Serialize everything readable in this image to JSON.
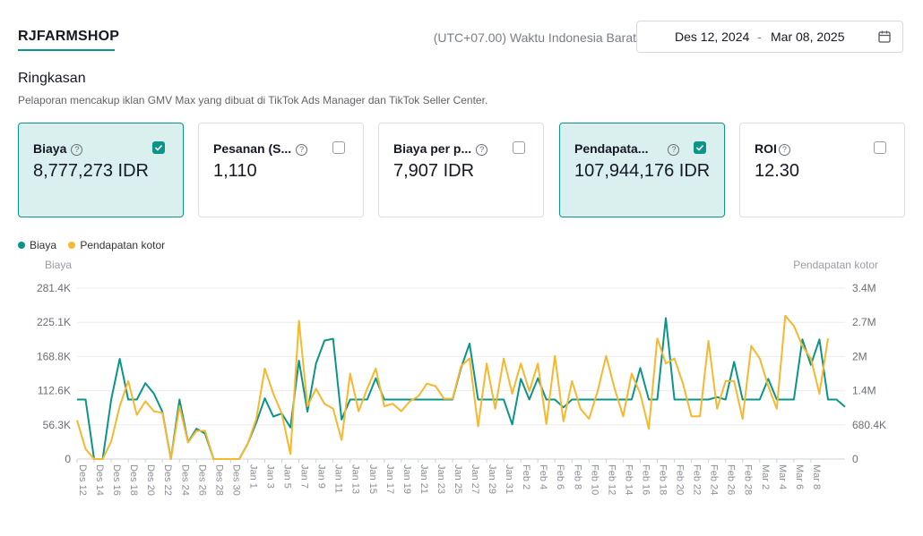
{
  "shop": {
    "name": "RJFARMSHOP"
  },
  "header": {
    "timezone": "(UTC+07.00) Waktu Indonesia Barat",
    "date_start": "Des 12, 2024",
    "date_sep": "-",
    "date_end": "Mar 08, 2025",
    "calendar_icon": "calendar-icon"
  },
  "summary": {
    "title": "Ringkasan",
    "description": "Pelaporan mencakup iklan GMV Max yang dibuat di TikTok Ads Manager dan TikTok Seller Center."
  },
  "cards": [
    {
      "label": "Biaya",
      "value": "8,777,273 IDR",
      "checked": true
    },
    {
      "label": "Pesanan (S...",
      "value": "1,110",
      "checked": false
    },
    {
      "label": "Biaya per p...",
      "value": "7,907 IDR",
      "checked": false
    },
    {
      "label": "Pendapata...",
      "value": "107,944,176 IDR",
      "checked": true
    },
    {
      "label": "ROI",
      "value": "12.30",
      "checked": false
    }
  ],
  "legend": {
    "series1": "Biaya",
    "series2": "Pendapatan kotor"
  },
  "colors": {
    "biaya": "#0d9488",
    "pendapatan": "#f5b82e",
    "accent": "#0d9488"
  },
  "chart_data": {
    "type": "line",
    "left_axis_title": "Biaya",
    "right_axis_title": "Pendapatan kotor",
    "left_ticks": [
      "0",
      "56.3K",
      "112.6K",
      "168.8K",
      "225.1K",
      "281.4K"
    ],
    "right_ticks": [
      "0",
      "680.4K",
      "1.4M",
      "2M",
      "2.7M",
      "3.4M"
    ],
    "left_ylim": [
      0,
      281400
    ],
    "right_ylim": [
      0,
      3400000
    ],
    "x_labels": [
      "Des 12",
      "Des 14",
      "Des 16",
      "Des 18",
      "Des 20",
      "Des 22",
      "Des 24",
      "Des 26",
      "Des 28",
      "Des 30",
      "Jan 1",
      "Jan 3",
      "Jan 5",
      "Jan 7",
      "Jan 9",
      "Jan 11",
      "Jan 13",
      "Jan 15",
      "Jan 17",
      "Jan 19",
      "Jan 21",
      "Jan 23",
      "Jan 25",
      "Jan 27",
      "Jan 29",
      "Jan 31",
      "Feb 2",
      "Feb 4",
      "Feb 6",
      "Feb 8",
      "Feb 10",
      "Feb 12",
      "Feb 14",
      "Feb 16",
      "Feb 18",
      "Feb 20",
      "Feb 22",
      "Feb 24",
      "Feb 26",
      "Feb 28",
      "Mar 2",
      "Mar 4",
      "Mar 6",
      "Mar 8"
    ],
    "grid": true,
    "series": [
      {
        "name": "Biaya",
        "axis": "left",
        "values": [
          98000,
          98000,
          0,
          0,
          98000,
          165000,
          98000,
          98000,
          125000,
          108000,
          78000,
          0,
          98000,
          28000,
          50000,
          42000,
          0,
          0,
          0,
          0,
          25000,
          60000,
          100000,
          70000,
          75000,
          52000,
          162000,
          78000,
          157000,
          195000,
          198000,
          65000,
          98000,
          98000,
          98000,
          133000,
          98000,
          98000,
          98000,
          98000,
          98000,
          98000,
          98000,
          98000,
          98000,
          150000,
          190000,
          98000,
          98000,
          98000,
          98000,
          57000,
          132000,
          98000,
          133000,
          98000,
          98000,
          85000,
          98000,
          98000,
          98000,
          98000,
          98000,
          98000,
          98000,
          98000,
          150000,
          98000,
          98000,
          232000,
          98000,
          98000,
          98000,
          98000,
          98000,
          102000,
          98000,
          160000,
          98000,
          98000,
          98000,
          132000,
          98000,
          98000,
          98000,
          197000,
          155000,
          197000,
          98000,
          98000,
          86000
        ]
      },
      {
        "name": "Pendapatan kotor",
        "axis": "right",
        "values": [
          770000,
          200000,
          0,
          0,
          350000,
          1050000,
          1550000,
          880000,
          1150000,
          950000,
          920000,
          0,
          1050000,
          330000,
          560000,
          560000,
          0,
          0,
          0,
          0,
          300000,
          800000,
          1800000,
          1300000,
          900000,
          100000,
          2750000,
          1050000,
          1400000,
          1100000,
          1000000,
          380000,
          1700000,
          950000,
          1400000,
          1800000,
          1050000,
          1100000,
          950000,
          1150000,
          1250000,
          1500000,
          1450000,
          1200000,
          1200000,
          1850000,
          2000000,
          650000,
          1900000,
          1000000,
          2000000,
          1300000,
          1900000,
          1350000,
          1900000,
          700000,
          2050000,
          750000,
          1550000,
          1000000,
          800000,
          1350000,
          2050000,
          1400000,
          850000,
          1700000,
          1300000,
          600000,
          2400000,
          1900000,
          2000000,
          1500000,
          850000,
          850000,
          2350000,
          1000000,
          1550000,
          1550000,
          800000,
          2250000,
          2000000,
          1450000,
          1000000,
          2850000,
          2650000,
          2250000,
          2000000,
          1300000,
          2400000
        ]
      }
    ]
  }
}
